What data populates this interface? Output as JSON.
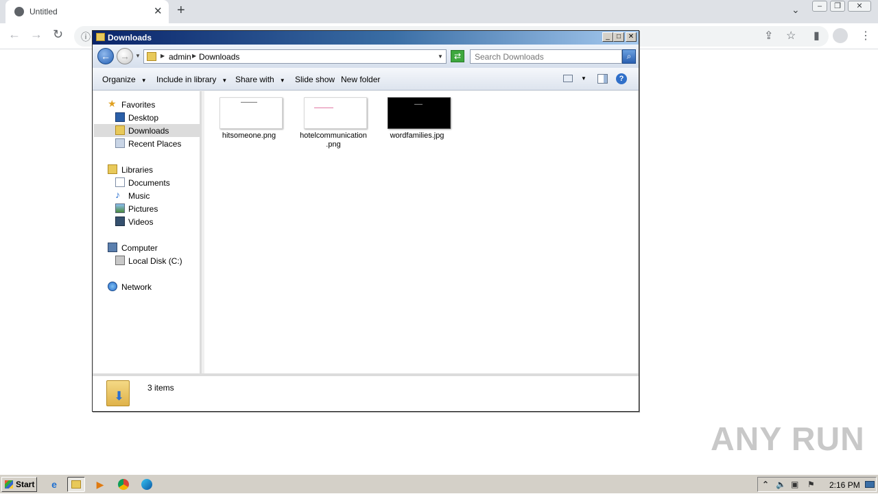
{
  "browser": {
    "tab_title": "Untitled",
    "tab_close": "✕",
    "new_tab": "+"
  },
  "explorer": {
    "title": "Downloads",
    "address": {
      "crumbs": [
        "admin",
        "Downloads"
      ]
    },
    "search_placeholder": "Search Downloads",
    "commands": {
      "organize": "Organize",
      "include_in_library": "Include in library",
      "share_with": "Share with",
      "slide_show": "Slide show",
      "new_folder": "New folder"
    },
    "nav": {
      "favorites": "Favorites",
      "desktop": "Desktop",
      "downloads": "Downloads",
      "recent_places": "Recent Places",
      "libraries": "Libraries",
      "documents": "Documents",
      "music": "Music",
      "pictures": "Pictures",
      "videos": "Videos",
      "computer": "Computer",
      "local_disk": "Local Disk (C:)",
      "network": "Network"
    },
    "files": [
      {
        "name": "hitsomeone.png"
      },
      {
        "name_line1": "hotelcommunication",
        "name_line2": ".png"
      },
      {
        "name": "wordfamilies.jpg"
      }
    ],
    "status": {
      "item_count": "3 items"
    }
  },
  "watermark": "ANY RUN",
  "taskbar": {
    "start": "Start",
    "clock": "2:16 PM"
  }
}
